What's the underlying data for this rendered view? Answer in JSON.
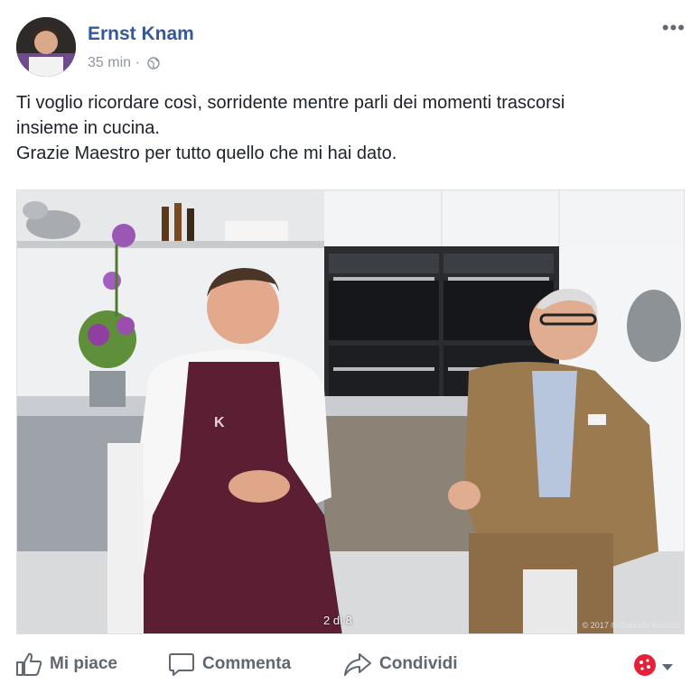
{
  "post": {
    "author": "Ernst Knam",
    "time": "35 min ·",
    "more_label": "•••",
    "text_lines": [
      "Ti voglio ricordare così, sorridente mentre parli dei momenti trascorsi",
      "insieme in cucina.",
      "Grazie Maestro per tutto quello che mi hai dato."
    ],
    "photo": {
      "counter": "2 di 8",
      "watermark": "© 2017 © Gabriele Basilico"
    }
  },
  "actions": {
    "like": "Mi piace",
    "comment": "Commenta",
    "share": "Condividi"
  },
  "colors": {
    "link": "#365899",
    "secondary": "#90949c",
    "action": "#616770",
    "reaction_badge": "#e4203a"
  },
  "icons": [
    "globe-icon",
    "thumbs-up-icon",
    "comment-icon",
    "share-icon",
    "reaction-icon",
    "chevron-down-icon",
    "more-icon"
  ]
}
